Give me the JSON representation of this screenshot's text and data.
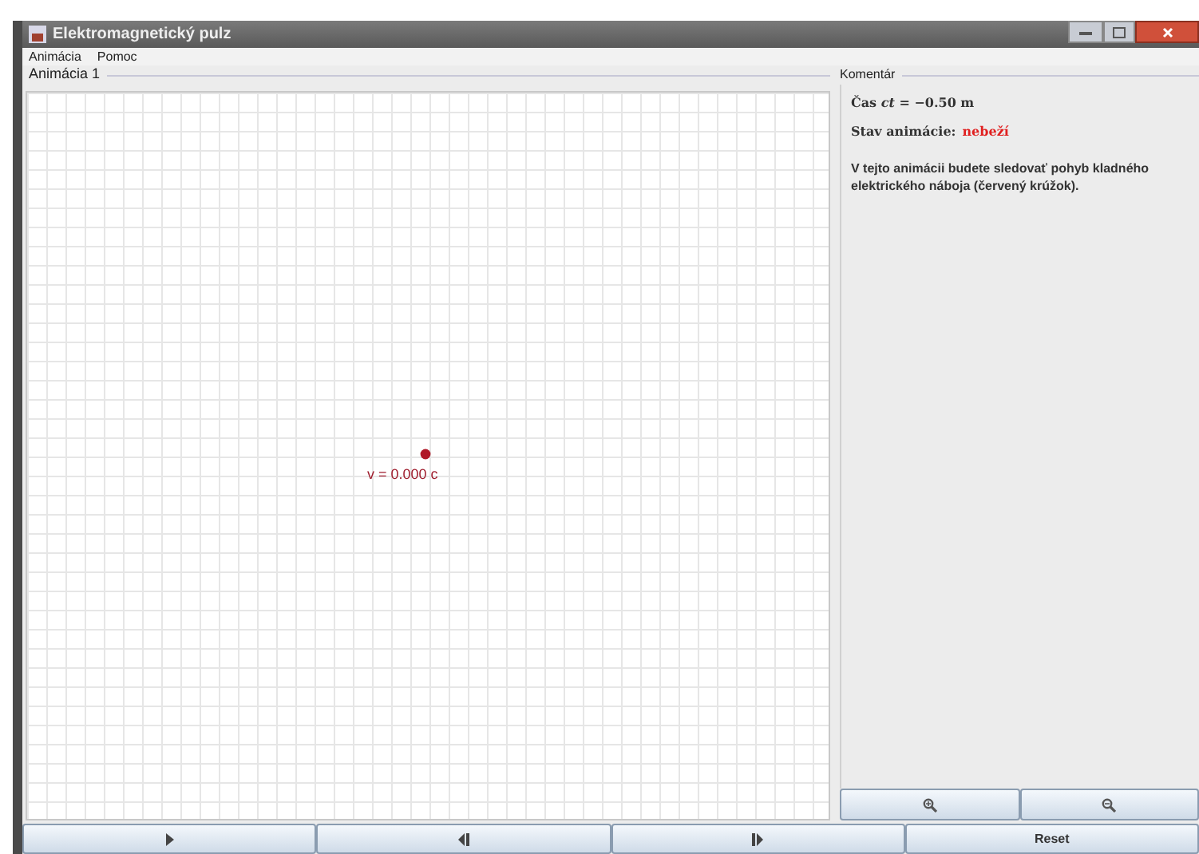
{
  "window": {
    "title": "Elektromagnetický pulz"
  },
  "menu": [
    "Animácia",
    "Pomoc"
  ],
  "animation_panel": {
    "title": "Animácia 1",
    "charge_label": "v = 0.000 c"
  },
  "comment_panel": {
    "title": "Komentár",
    "time": "Čas *ct* = −0.50 m",
    "status_label": "Stav animácie:",
    "status_value": "nebeží",
    "running": false,
    "description": "V tejto animácii budete sledovať pohyb kladného elektrického náboja (červený krúžok)."
  },
  "zoom_buttons": [
    {
      "kind": "zoom-in"
    },
    {
      "kind": "zoom-out"
    }
  ],
  "controls": [
    {
      "kind": "play"
    },
    {
      "kind": "step-back"
    },
    {
      "kind": "step-forward"
    },
    {
      "kind": "text",
      "label": "Reset"
    }
  ]
}
